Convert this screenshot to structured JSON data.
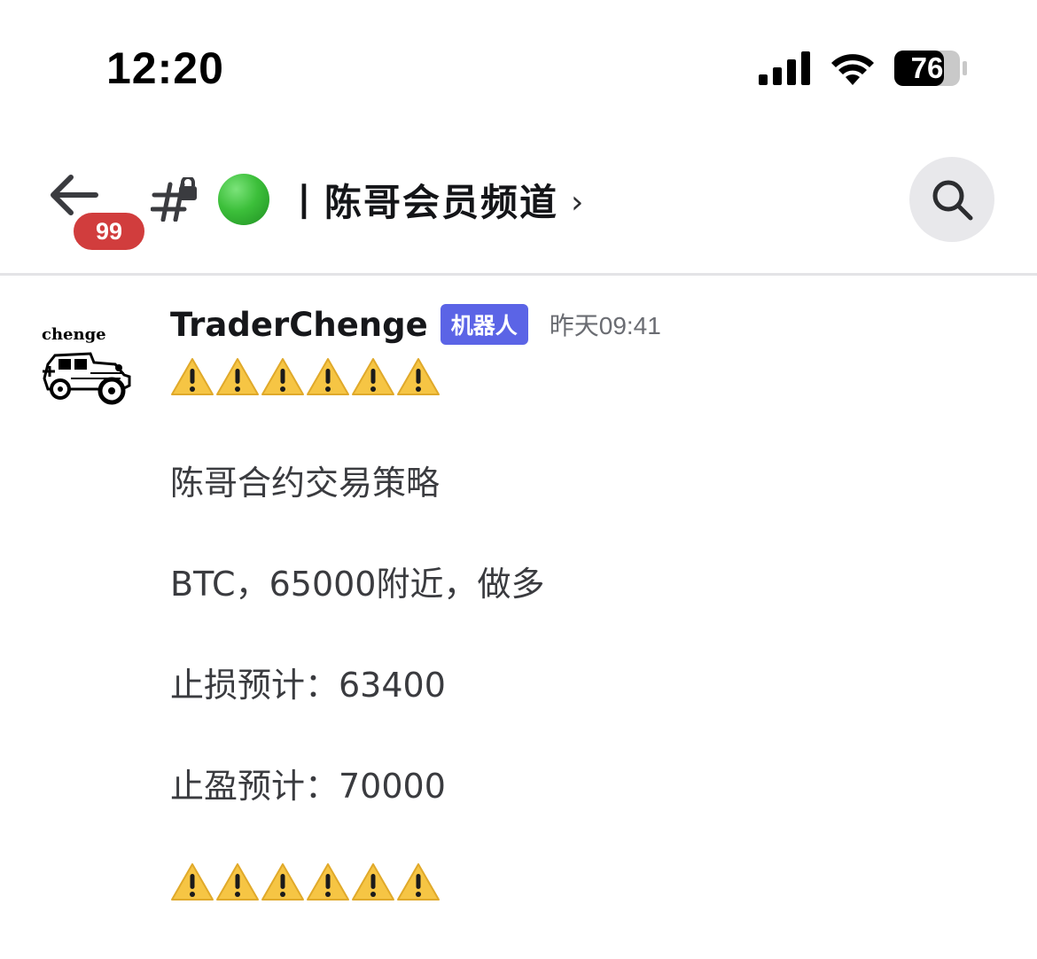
{
  "status_bar": {
    "time": "12:20",
    "battery_level": "76",
    "battery_fraction": 0.76
  },
  "header": {
    "back_badge": "99",
    "channel_title": "丨陈哥会员频道",
    "chevron": "›"
  },
  "message": {
    "author": "TraderChenge",
    "bot_tag": "机器人",
    "timestamp": "昨天09:41",
    "avatar_text": "chenge",
    "warning_count": 6,
    "lines": {
      "l1": "陈哥合约交易策略",
      "l2": "BTC，65000附近，做多",
      "l3": "止损预计：63400",
      "l4": "止盈预计：70000"
    }
  },
  "colors": {
    "badge": "#d13d3d",
    "bot_tag": "#5b64e6",
    "warning": "#f6c544",
    "search_bg": "#e8e8eb"
  }
}
